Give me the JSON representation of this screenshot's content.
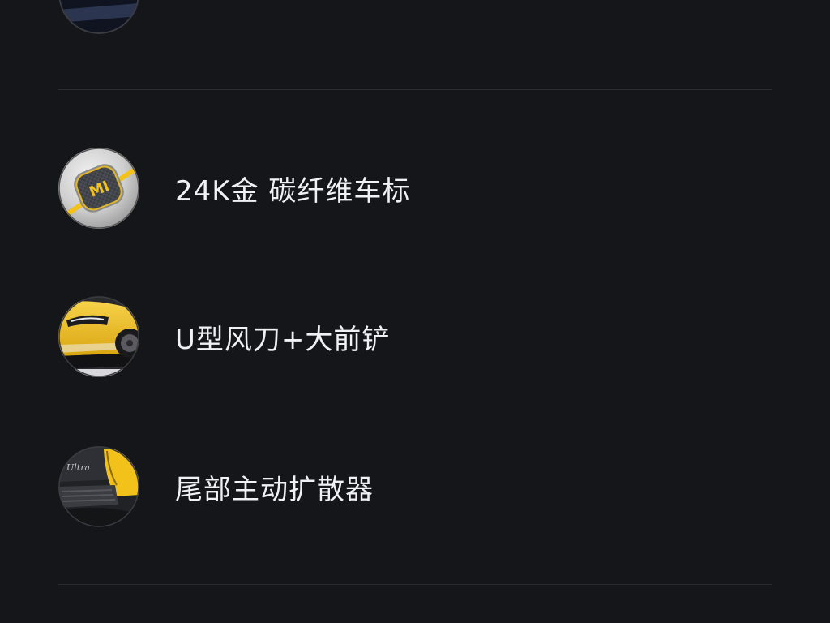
{
  "features": [
    {
      "label": "",
      "icon": "carbon-fiber-part-thumbnail",
      "partial": true
    },
    {
      "label": "24K金 碳纤维车标",
      "icon": "gold-carbon-badge-thumbnail"
    },
    {
      "label": "U型风刀+大前铲",
      "icon": "front-splitter-thumbnail"
    },
    {
      "label": "尾部主动扩散器",
      "icon": "rear-diffuser-thumbnail"
    }
  ],
  "colors": {
    "background": "#151619",
    "divider": "#2a2b30",
    "text": "#f1f1f3",
    "accent_yellow": "#f2c21b"
  }
}
